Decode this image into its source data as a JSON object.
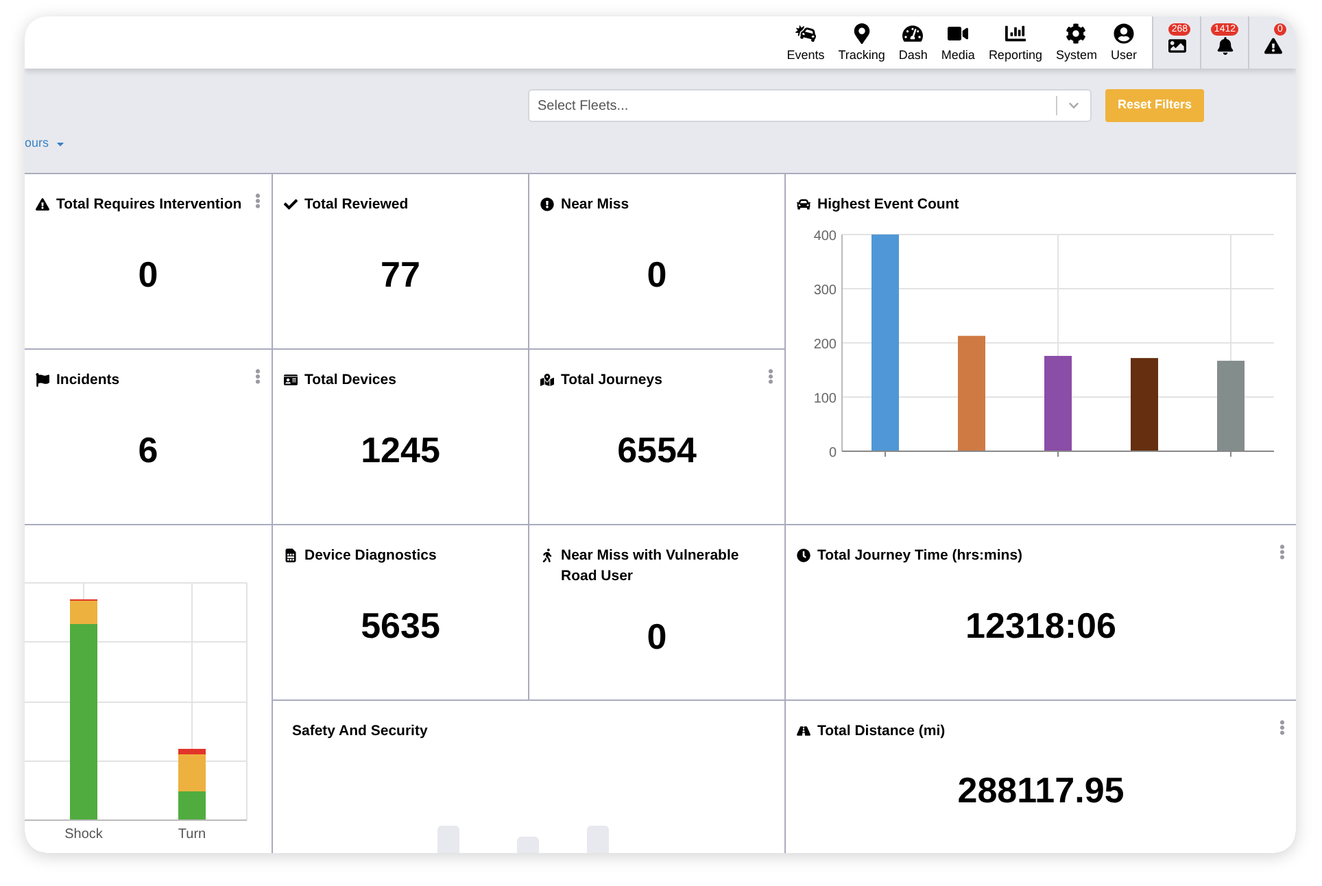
{
  "nav": [
    {
      "label": "Events"
    },
    {
      "label": "Tracking"
    },
    {
      "label": "Dash"
    },
    {
      "label": "Media"
    },
    {
      "label": "Reporting"
    },
    {
      "label": "System"
    },
    {
      "label": "User"
    }
  ],
  "alerts": [
    {
      "count": "268"
    },
    {
      "count": "1412"
    },
    {
      "count": "0"
    }
  ],
  "filters": {
    "fleet_select": {
      "placeholder": "Select Fleets..."
    },
    "reset_button": "Reset Filters",
    "range_dropdown": "ours"
  },
  "tiles": [
    {
      "kind": "stat",
      "title": "Total Requires Intervention",
      "value": "0",
      "menu": true
    },
    {
      "kind": "stat",
      "title": "Total Reviewed",
      "value": "77",
      "menu": false
    },
    {
      "kind": "stat",
      "title": "Near Miss",
      "value": "0",
      "menu": false
    },
    {
      "kind": "bar_chart",
      "title": "Highest Event Count",
      "chart_data": {
        "type": "bar",
        "grid": true,
        "yticks": [
          0,
          100,
          200,
          300,
          400
        ],
        "ylim": [
          0,
          400
        ],
        "series": [
          {
            "color": "#4f97d6",
            "values": [
              400,
              null,
              null,
              null,
              null
            ]
          },
          {
            "color": "#cf7a43",
            "values": [
              null,
              213,
              null,
              null,
              null
            ]
          },
          {
            "color": "#8a4da8",
            "values": [
              null,
              null,
              176,
              null,
              null
            ]
          },
          {
            "color": "#652f10",
            "values": [
              null,
              null,
              null,
              172,
              null
            ]
          },
          {
            "color": "#838d8c",
            "values": [
              null,
              null,
              null,
              null,
              167
            ]
          }
        ]
      }
    },
    {
      "kind": "stat",
      "title": "Incidents",
      "value": "6",
      "menu": true
    },
    {
      "kind": "stat",
      "title": "Total Devices",
      "value": "1245",
      "menu": false
    },
    {
      "kind": "stat",
      "title": "Total Journeys",
      "value": "6554",
      "menu": true
    },
    {
      "kind": "stacked_chart",
      "labels": [
        "Shock",
        "Turn"
      ]
    },
    {
      "kind": "stat",
      "title": "Device Diagnostics",
      "value": "5635",
      "menu": false
    },
    {
      "kind": "stat",
      "title": "Near Miss with Vulnerable Road User",
      "value": "0",
      "menu": false
    },
    {
      "kind": "stat",
      "title": "Total Journey Time (hrs:mins)",
      "value": "12318:06",
      "menu": true
    },
    {
      "kind": "panel",
      "title": "Safety And Security"
    },
    {
      "kind": "stat",
      "title": "Total Distance (mi)",
      "value": "288117.95",
      "menu": true
    }
  ]
}
